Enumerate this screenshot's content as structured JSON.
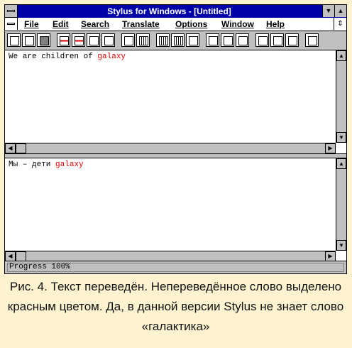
{
  "window": {
    "title": "Stylus for Windows - [Untitled]"
  },
  "menu": [
    "File",
    "Edit",
    "Search",
    "Translate",
    "Options",
    "Window",
    "Help"
  ],
  "toolbar_icons": [
    "new-doc-icon",
    "open-icon",
    "save-icon",
    "translate-red-icon",
    "translate-both-icon",
    "dictionary-icon",
    "tree-icon",
    "layout-icon",
    "grid-icon",
    "paste-icon",
    "copy-icon",
    "cut-icon",
    "undo-icon",
    "find-icon",
    "find-next-icon",
    "split-down-icon",
    "split-right-icon",
    "import-icon",
    "zoom-icon"
  ],
  "source_pane": {
    "prefix": "We are children of ",
    "untranslated": "galaxy"
  },
  "target_pane": {
    "prefix": "Мы – дети ",
    "untranslated": "galaxy"
  },
  "status": {
    "text": "Progress 100%"
  },
  "colors": {
    "title_bg": "#0000a8",
    "untranslated": "#e00000",
    "window_bg": "#c0c0c0",
    "page_bg": "#fdf3d0"
  },
  "caption": "Рис. 4. Текст переведён. Непереведённое слово выделено красным цветом. Да, в данной версии Stylus не знает слово «галактика»"
}
